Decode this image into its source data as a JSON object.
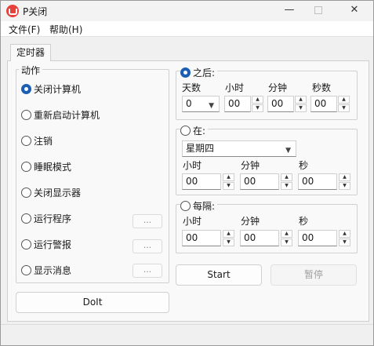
{
  "window": {
    "title": "P关闭"
  },
  "menu": {
    "file": "文件(F)",
    "help": "帮助(H)"
  },
  "tabs": [
    {
      "label": "定时器"
    }
  ],
  "action_group": {
    "title": "动作",
    "options": [
      {
        "label": "关闭计算机",
        "checked": true
      },
      {
        "label": "重新启动计算机",
        "checked": false
      },
      {
        "label": "注销",
        "checked": false
      },
      {
        "label": "睡眠模式",
        "checked": false
      },
      {
        "label": "关闭显示器",
        "checked": false
      },
      {
        "label": "运行程序",
        "checked": false,
        "browse": "..."
      },
      {
        "label": "运行警报",
        "checked": false,
        "browse": "..."
      },
      {
        "label": "显示消息",
        "checked": false,
        "browse": "..."
      }
    ]
  },
  "after_group": {
    "title": "之后:",
    "checked": true,
    "labels": {
      "days": "天数",
      "hours": "小时",
      "minutes": "分钟",
      "seconds": "秒数"
    },
    "values": {
      "days": "0",
      "hours": "00",
      "minutes": "00",
      "seconds": "00"
    }
  },
  "at_group": {
    "title": "在:",
    "checked": false,
    "weekday": "星期四",
    "labels": {
      "hours": "小时",
      "minutes": "分钟",
      "seconds": "秒"
    },
    "values": {
      "hours": "00",
      "minutes": "00",
      "seconds": "00"
    }
  },
  "every_group": {
    "title": "每隔:",
    "checked": false,
    "labels": {
      "hours": "小时",
      "minutes": "分钟",
      "seconds": "秒"
    },
    "values": {
      "hours": "00",
      "minutes": "00",
      "seconds": "00"
    }
  },
  "buttons": {
    "doit": "DoIt",
    "start": "Start",
    "pause": "暂停"
  },
  "colors": {
    "radio_checked": "#1a5fb4",
    "app_icon": "#e8403a"
  }
}
